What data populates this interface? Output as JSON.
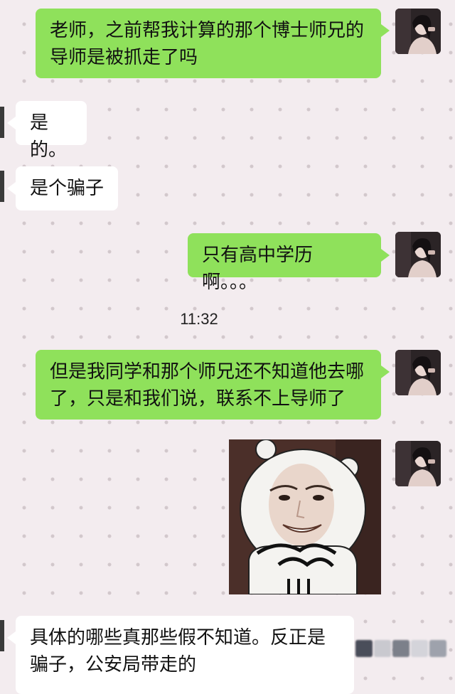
{
  "messages": {
    "m1": "老师，之前帮我计算的那个博士师兄的导师是被抓走了吗",
    "m2": "是的。",
    "m3": "是个骗子",
    "m4": "只有高中学历啊。。。",
    "m5": "但是我同学和那个师兄还不知道他去哪了，只是和我们说，联系不上导师了",
    "m6": "具体的哪些真那些假不知道。反正是骗子，公安局带走的"
  },
  "timestamp": "11:32",
  "icons": {
    "avatar": "user-avatar-photo",
    "sticker": "meme-face-sticker"
  },
  "colors": {
    "sent_bubble": "#8fe15b",
    "received_bubble": "#ffffff",
    "background": "#f3ecef"
  }
}
